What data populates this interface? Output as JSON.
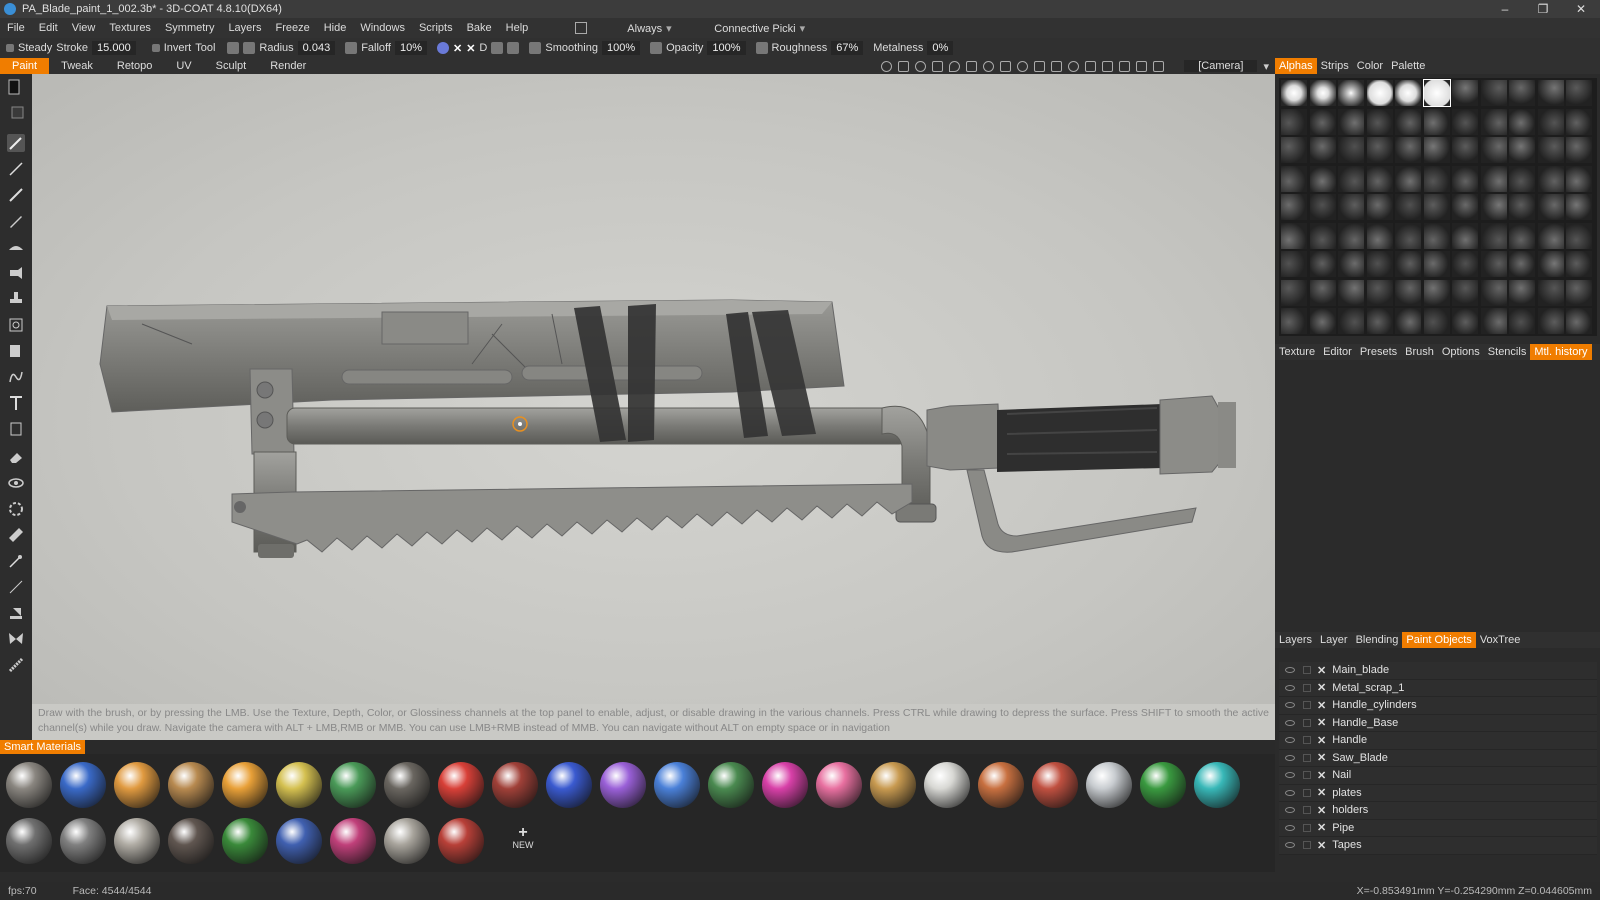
{
  "window": {
    "title": "PA_Blade_paint_1_002.3b* - 3D-COAT 4.8.10(DX64)"
  },
  "menu": {
    "items": [
      "File",
      "Edit",
      "View",
      "Textures",
      "Symmetry",
      "Layers",
      "Freeze",
      "Hide",
      "Windows",
      "Scripts",
      "Bake",
      "Help"
    ],
    "always": "Always",
    "connective": "Connective Picki"
  },
  "toolbar": {
    "steady": "Steady",
    "stroke_label": "Stroke",
    "stroke_value": "15.000",
    "invert": "Invert",
    "tool": "Tool",
    "radius_label": "Radius",
    "radius_value": "0.043",
    "falloff_label": "Falloff",
    "falloff_value": "10%",
    "d_label": "D",
    "smoothing_label": "Smoothing",
    "smoothing_value": "100%",
    "opacity_label": "Opacity",
    "opacity_value": "100%",
    "roughness_label": "Roughness",
    "roughness_value": "67%",
    "metalness_label": "Metalness",
    "metalness_value": "0%"
  },
  "rooms": {
    "tabs": [
      "Paint",
      "Tweak",
      "Retopo",
      "UV",
      "Sculpt",
      "Render"
    ],
    "active": "Paint",
    "camera": "[Camera]"
  },
  "hint": "Draw with the brush, or by pressing the LMB. Use the Texture, Depth, Color, or Glossiness channels at the top panel to enable, adjust, or disable drawing in the various channels. Press CTRL while drawing to depress the surface. Press SHIFT to smooth the active channel(s) while you draw. Navigate the camera with ALT + LMB,RMB or MMB. You can use LMB+RMB instead of MMB. You can navigate without ALT on empty space or in navigation",
  "smart_materials": {
    "label": "Smart Materials",
    "new_label": "NEW",
    "row1": [
      "#8a8680",
      "#3a6ac8",
      "#e09a40",
      "#b88a50",
      "#e8a038",
      "#d4c050",
      "#4a9a58",
      "#6a6660",
      "#d84038",
      "#a04038",
      "#3a5ad0",
      "#9a60d8",
      "#4a80d8",
      "#4a8a50",
      "#d840a8",
      "#e870a0",
      "#c89a50",
      "#d8d8d4",
      "#c87040",
      "#c05040",
      "#c8ccd0",
      "#3a9a40",
      "#38b8b8"
    ],
    "row2": [
      "#707070",
      "#808080",
      "#b0aca4",
      "#605650",
      "#3a8a3a",
      "#4060b0",
      "#c0407a",
      "#a8a49c",
      "#b84038"
    ]
  },
  "right_panel": {
    "top_tabs": [
      "Alphas",
      "Strips",
      "Color",
      "Palette"
    ],
    "top_active": "Alphas",
    "mid_tabs": [
      "Texture",
      "Editor",
      "Presets",
      "Brush",
      "Options",
      "Stencils",
      "Mtl. history"
    ],
    "mid_active": "Mtl. history",
    "bottom_tabs": [
      "Layers",
      "Layer",
      "Blending",
      "Paint Objects",
      "VoxTree"
    ],
    "bottom_active": "Paint Objects",
    "objects": [
      "Main_blade",
      "Metal_scrap_1",
      "Handle_cylinders",
      "Handle_Base",
      "Handle",
      "Saw_Blade",
      "Nail",
      "plates",
      "holders",
      "Pipe",
      "Tapes"
    ]
  },
  "status": {
    "fps": "fps:70",
    "face": "Face: 4544/4544",
    "coords": "X=-0.853491mm  Y=-0.254290mm  Z=0.044605mm"
  }
}
